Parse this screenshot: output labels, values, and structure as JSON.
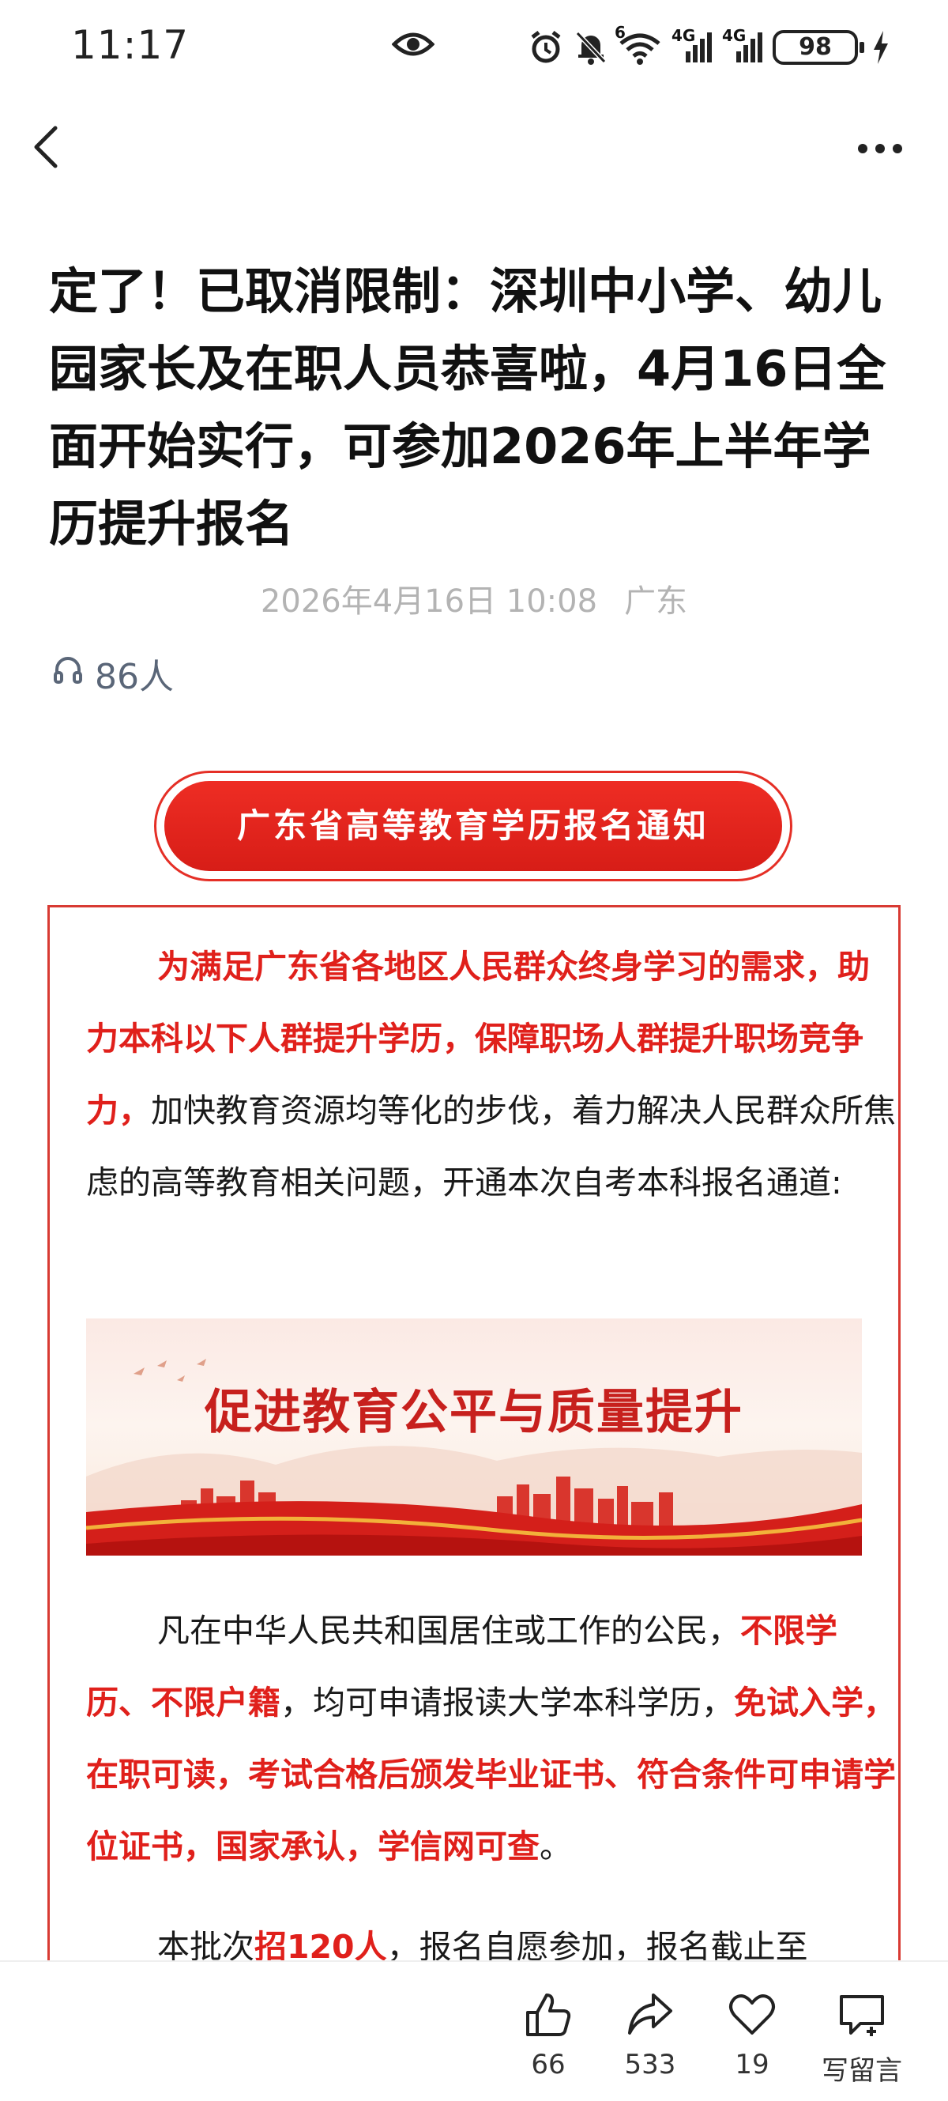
{
  "status_bar": {
    "time": "11:17",
    "signal1_label": "4G",
    "signal2_label": "4G",
    "wifi_badge": "6",
    "battery": "98",
    "icons": [
      "eye-icon",
      "alarm-icon",
      "mute-bell-icon",
      "wifi-icon",
      "signal-icon",
      "signal-icon",
      "battery-icon",
      "charging-icon"
    ]
  },
  "nav": {
    "icons": [
      "back-arrow-icon",
      "more-icon"
    ]
  },
  "article": {
    "title": "定了！已取消限制：深圳中小学、幼儿园家长及在职人员恭喜啦，4月16日全面开始实行，可参加2026年上半年学历提升报名",
    "date": "2026年4月16日 10:08",
    "location": "广东",
    "listen_count": "86人",
    "banner": "广东省高等教育学历报名通知",
    "p1": {
      "red": "为满足广东省各地区人民群众终身学习的需求，助力本科以下人群提升学历，保障职场人群提升职场竞争力，",
      "normal": "加快教育资源均等化的步伐，着力解决人民群众所焦虑的高等教育相关问题，开通本次自考本科报名通道:"
    },
    "image_text": "促进教育公平与质量提升",
    "p2": {
      "t1": "凡在中华人民共和国居住或工作的公民，",
      "r1": "不限学历、不限户籍",
      "t2": "，均可申请报读大学本科学历，",
      "r2": "免试入学，在职可读，考试合格后颁发毕业证书、符合条件可申请学位证书，国家承认，学信网可查",
      "t3": "。"
    },
    "p3": {
      "t1": "本批次",
      "r1": "招120人",
      "t2": "，报名自愿参加，报名截止至"
    }
  },
  "actions": {
    "like_count": "66",
    "share_count": "533",
    "fav_count": "19",
    "comment_label": "写留言"
  },
  "colors": {
    "accent_red": "#e0201b",
    "banner_red": "#ee2d24",
    "meta_gray": "#b3b3b3"
  }
}
